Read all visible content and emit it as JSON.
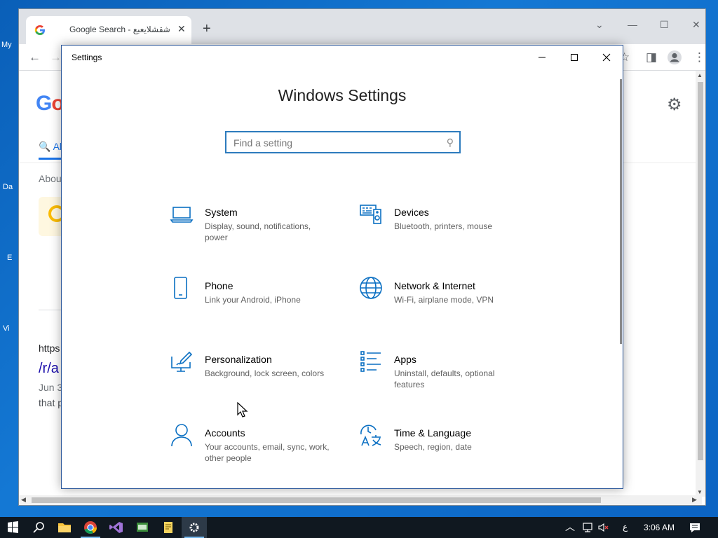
{
  "desktop": {
    "fragments": [
      "My",
      "Da",
      "E",
      "Vi"
    ]
  },
  "chrome": {
    "tab_title": "Google Search - شقشلايعبع",
    "tab_close": "✕",
    "new_tab": "+",
    "window_controls": {
      "tabsearch": "⌄",
      "minimize": "—",
      "maximize": "☐",
      "close": "✕"
    },
    "toolbar": {
      "back": "←",
      "forward": "→",
      "bookmark": "☆",
      "sidepanel": "◨",
      "menu": "⋮"
    },
    "page": {
      "logo_partial": "Go",
      "search_tab_partial": "Al",
      "about_partial": "Abou",
      "result_url_partial": "https",
      "result_title_partial": "/r/a",
      "result_date_partial": "Jun 3",
      "result_snippet_partial": "that p"
    }
  },
  "settings": {
    "window_title": "Settings",
    "heading": "Windows Settings",
    "search_placeholder": "Find a setting",
    "accent_color": "#0a6fc2",
    "items": [
      {
        "name": "System",
        "desc": "Display, sound, notifications, power",
        "icon": "laptop-icon"
      },
      {
        "name": "Devices",
        "desc": "Bluetooth, printers, mouse",
        "icon": "devices-icon"
      },
      {
        "name": "Phone",
        "desc": "Link your Android, iPhone",
        "icon": "phone-icon"
      },
      {
        "name": "Network & Internet",
        "desc": "Wi-Fi, airplane mode, VPN",
        "icon": "globe-icon"
      },
      {
        "name": "Personalization",
        "desc": "Background, lock screen, colors",
        "icon": "paint-icon"
      },
      {
        "name": "Apps",
        "desc": "Uninstall, defaults, optional features",
        "icon": "apps-list-icon"
      },
      {
        "name": "Accounts",
        "desc": "Your accounts, email, sync, work, other people",
        "icon": "person-icon"
      },
      {
        "name": "Time & Language",
        "desc": "Speech, region, date",
        "icon": "time-language-icon"
      }
    ]
  },
  "taskbar": {
    "input_indicator": "ع",
    "clock": "3:06 AM"
  }
}
